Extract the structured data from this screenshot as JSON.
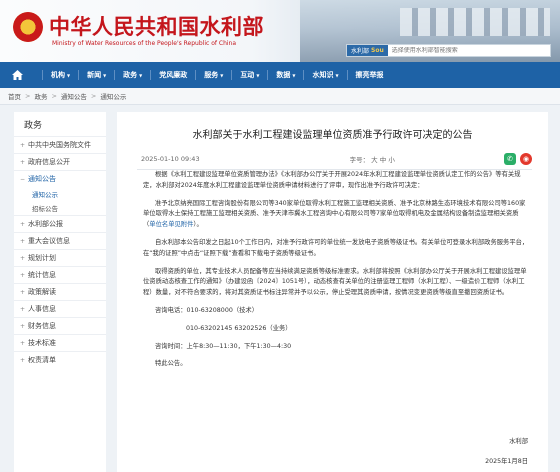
{
  "header": {
    "title": "中华人民共和国水利部",
    "subtitle": "Ministry of Water Resources of the People's Republic of China",
    "search_tag": "水利部",
    "search_tag_brand": "Sou",
    "search_placeholder": "选择使用水利部智能搜索",
    "colors": {
      "brand_red": "#c4161c",
      "nav_blue": "#1e62a6"
    }
  },
  "nav": {
    "home_icon": "home-icon",
    "items": [
      {
        "label": "机构",
        "dropdown": true
      },
      {
        "label": "新闻",
        "dropdown": true
      },
      {
        "label": "政务",
        "dropdown": true
      },
      {
        "label": "党风廉政",
        "dropdown": false
      },
      {
        "label": "服务",
        "dropdown": true
      },
      {
        "label": "互动",
        "dropdown": true
      },
      {
        "label": "数据",
        "dropdown": true
      },
      {
        "label": "水知识",
        "dropdown": true
      },
      {
        "label": "擦亮举报",
        "dropdown": false
      }
    ]
  },
  "breadcrumb": [
    "首页",
    "政务",
    "通知公告",
    "通知公示"
  ],
  "sidebar": {
    "title": "政务",
    "items": [
      {
        "label": "中共中央国务院文件"
      },
      {
        "label": "政府信息公开"
      },
      {
        "label": "通知公告",
        "active": true,
        "subitems": [
          "通知公示",
          "招标公告"
        ]
      },
      {
        "label": "水利部公报"
      },
      {
        "label": "重大会议信息"
      },
      {
        "label": "规划计划"
      },
      {
        "label": "统计信息"
      },
      {
        "label": "政策解读"
      },
      {
        "label": "人事信息"
      },
      {
        "label": "财务信息"
      },
      {
        "label": "技术标准"
      },
      {
        "label": "权责清单"
      }
    ]
  },
  "article": {
    "title": "水利部关于水利工程建设监理单位资质准予行政许可决定的公告",
    "date": "2025-01-10 09:43",
    "font_label": "字号",
    "font_sizes": [
      "大",
      "中",
      "小"
    ],
    "share_icons": [
      "wechat-icon",
      "weibo-icon"
    ],
    "p1": "根据《水利工程建设监理单位资质管理办法》《水利部办公厅关于开展2024年水利工程建设监理单位资质认定工作的公告》等有关规定，水利部对2024年度水利工程建设监理单位资质申请材料进行了评审，现作出准予行政许可决定：",
    "p2a": "准予北京纳亮国际工程咨询股份有限公司等340家单位取得水利工程施工监理相关资质、准予北京林路生态环境技术有限公司等160家单位取得水土保持工程施工监理相关资质、准予天津市冀水工程咨询中心有限公司等7家单位取得机电及金属结构设备制造监理相关资质（",
    "p2_link": "单位名单见附件",
    "p2b": "）。",
    "p3": "自水利部本公告印发之日起10个工作日内，对准予行政许可的单位统一发放电子资质等级证书。有关单位可登录水利部政务服务平台，在“我的证照”中点击“证照下载”查看和下载电子资质等级证书。",
    "p4": "取得资质的单位，其专业技术人员配备等应当持续满足资质等级标准要求。水利部将按照《水利部办公厅关于开展水利工程建设监理单位资质动态核查工作的通知》（办建设函〔2024〕1051号），动态核查有关单位的注册监理工程师（水利工程）、一级造价工程师（水利工程）数量，对不符合要求的，将对其资质证书标注异常并予以公示，停止受理其资质申请，按情况变更资质等级直至撤回资质证书。",
    "contact_phone_label": "咨询电话：",
    "phone1": "010-63208000（技术）",
    "phone2": "010-63202145  63202526（业务）",
    "contact_time": "咨询时间：上午8:30—11:30，下午1:30—4:30",
    "closing": "特此公告。",
    "signature": "水利部",
    "sign_date": "2025年1月8日"
  }
}
